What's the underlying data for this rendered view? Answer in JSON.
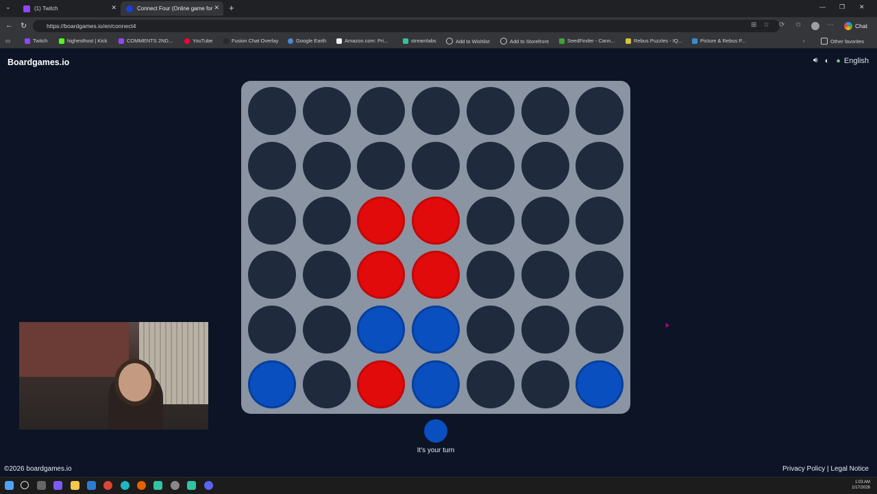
{
  "browser": {
    "tabs": [
      {
        "title": "(1) Twitch",
        "active": false
      },
      {
        "title": "Connect Four (Online game for 2...",
        "active": true
      }
    ],
    "url": "https://boardgames.io/en/connect4",
    "chat_label": "Chat",
    "bookmarks": [
      "Twitch",
      "highesthost | Kick",
      "COMMENTS 2ND...",
      "YouTube",
      "Fusion Chat Overlay",
      "Google Earth",
      "Amazon.com: Pri...",
      "streamlabs",
      "Add to Wishlist",
      "Add to Storefront",
      "SeedFinder - Cann...",
      "Rebus Puzzles - IQ...",
      "Picture & Rebus P..."
    ],
    "other_favorites": "Other favorites"
  },
  "page": {
    "brand": "Boardgames.io",
    "language": "English",
    "status": "It's your turn",
    "copyright": "©2026 boardgames.io",
    "privacy": "Privacy Policy",
    "separator": "|",
    "legal": "Legal Notice"
  },
  "board": {
    "rows": 6,
    "cols": 7,
    "cells": [
      [
        "empty",
        "empty",
        "empty",
        "empty",
        "empty",
        "empty",
        "empty"
      ],
      [
        "empty",
        "empty",
        "empty",
        "empty",
        "empty",
        "empty",
        "empty"
      ],
      [
        "empty",
        "empty",
        "red",
        "red",
        "empty",
        "empty",
        "empty"
      ],
      [
        "empty",
        "empty",
        "red",
        "red",
        "empty",
        "empty",
        "empty"
      ],
      [
        "empty",
        "empty",
        "blue",
        "blue",
        "empty",
        "empty",
        "empty"
      ],
      [
        "blue",
        "empty",
        "red",
        "blue",
        "empty",
        "empty",
        "blue"
      ]
    ],
    "colors": {
      "red": "#e10b0b",
      "blue": "#0a4fbf",
      "empty": "#1f2b3d",
      "board": "#8a94a3"
    },
    "current_player_color": "blue"
  },
  "taskbar": {
    "time": "1:03 AM",
    "date": "1/17/2026"
  }
}
